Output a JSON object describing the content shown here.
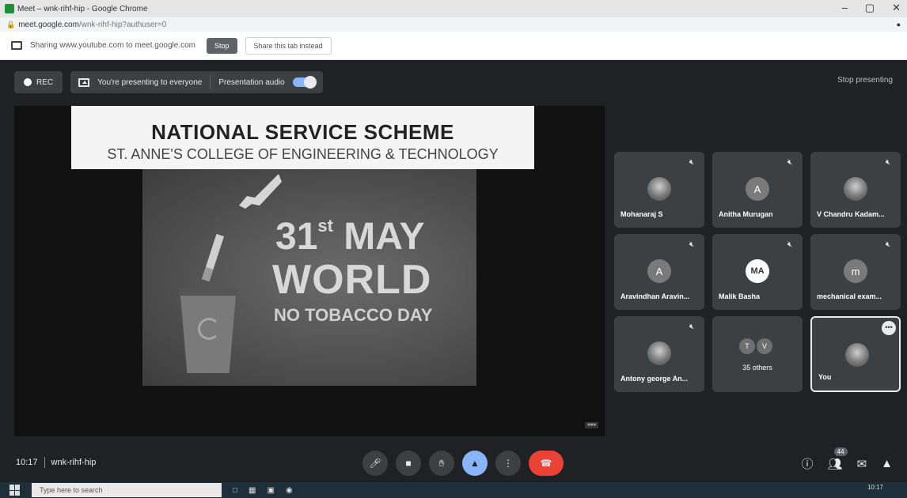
{
  "browser": {
    "window_title": "Meet – wnk-rihf-hip - Google Chrome",
    "url_host": "meet.google.com",
    "url_path": "/wnk-rihf-hip?authuser=0",
    "window_controls": [
      "–",
      "▢",
      "✕"
    ]
  },
  "sharebar": {
    "message": "Sharing www.youtube.com to meet.google.com",
    "stop_label": "Stop",
    "share_tab_label": "Share this tab instead"
  },
  "meet_topbar": {
    "rec_label": "REC",
    "presenting_label": "You're presenting to everyone",
    "presentation_audio_label": "Presentation audio",
    "stop_presenting_label": "Stop presenting"
  },
  "presentation": {
    "banner_title": "NATIONAL SERVICE SCHEME",
    "banner_subtitle": "ST. ANNE'S COLLEGE OF ENGINEERING & TECHNOLOGY",
    "slide_day_num": "31",
    "slide_day_suffix": "st",
    "slide_month": "MAY",
    "slide_world": "WORLD",
    "slide_event": "NO TOBACCO DAY"
  },
  "participants": [
    {
      "name": "Mohanaraj S",
      "initial": "",
      "avatar": "photo"
    },
    {
      "name": "Anitha Murugan",
      "initial": "A",
      "avatar": "grey"
    },
    {
      "name": "V Chandru Kadam...",
      "initial": "",
      "avatar": "photo"
    },
    {
      "name": "Aravindhan Aravin...",
      "initial": "A",
      "avatar": "grey"
    },
    {
      "name": "Malik Basha",
      "initial": "MA",
      "avatar": "white"
    },
    {
      "name": "mechanical exam...",
      "initial": "m",
      "avatar": "grey"
    },
    {
      "name": "Antony george An...",
      "initial": "",
      "avatar": "photo"
    }
  ],
  "others_tile": {
    "initials": [
      "T",
      "V"
    ],
    "label": "35 others"
  },
  "you_tile": {
    "name": "You"
  },
  "bottombar": {
    "time": "10:17",
    "meeting_code": "wnk-rihf-hip",
    "people_count": "44"
  },
  "taskbar": {
    "search_placeholder": "Type here to search",
    "clock": "10:17"
  }
}
